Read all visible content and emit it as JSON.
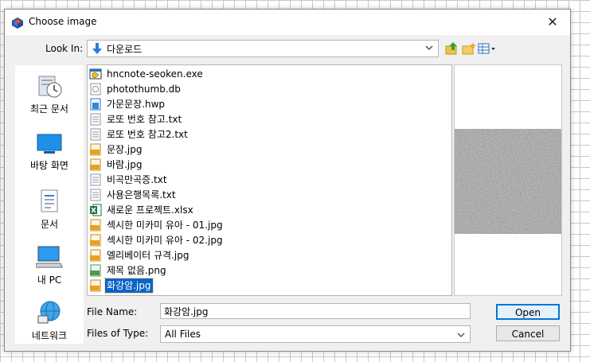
{
  "window": {
    "title": "Choose image",
    "close_glyph": "✕"
  },
  "toolbar": {
    "look_in_label": "Look In:",
    "look_in_value": "다운로드",
    "buttons": [
      "up-folder-icon",
      "new-folder-icon",
      "view-menu-icon"
    ]
  },
  "places": [
    {
      "label": "최근 문서",
      "icon": "recent-documents-icon"
    },
    {
      "label": "바탕 화면",
      "icon": "desktop-icon"
    },
    {
      "label": "문서",
      "icon": "documents-icon"
    },
    {
      "label": "내 PC",
      "icon": "computer-icon"
    },
    {
      "label": "네트워크",
      "icon": "network-icon"
    }
  ],
  "files": [
    {
      "name": "hncnote-seoken.exe",
      "icon": "exe-icon"
    },
    {
      "name": "photothumb.db",
      "icon": "db-file-icon"
    },
    {
      "name": "가문문장.hwp",
      "icon": "hwp-file-icon"
    },
    {
      "name": "로또 번호 참고.txt",
      "icon": "text-file-icon"
    },
    {
      "name": "로또 번호 참고2.txt",
      "icon": "text-file-icon"
    },
    {
      "name": "문장.jpg",
      "icon": "jpg-file-icon"
    },
    {
      "name": "바람.jpg",
      "icon": "jpg-file-icon"
    },
    {
      "name": "비곡만곡증.txt",
      "icon": "text-file-icon"
    },
    {
      "name": "사용은행목록.txt",
      "icon": "text-file-icon"
    },
    {
      "name": "새로운 프로젝트.xlsx",
      "icon": "excel-file-icon"
    },
    {
      "name": "섹시한 미카미 유아 - 01.jpg",
      "icon": "jpg-file-icon"
    },
    {
      "name": "섹시한 미카미 유아 - 02.jpg",
      "icon": "jpg-file-icon"
    },
    {
      "name": "엘리베이터 규격.jpg",
      "icon": "jpg-file-icon"
    },
    {
      "name": "제목 없음.png",
      "icon": "png-file-icon"
    },
    {
      "name": "화강암.jpg",
      "icon": "jpg-file-icon",
      "selected": true
    }
  ],
  "form": {
    "file_name_label": "File Name:",
    "file_name_value": "화강암.jpg",
    "file_type_label": "Files of Type:",
    "file_type_value": "All Files"
  },
  "buttons": {
    "open": "Open",
    "cancel": "Cancel"
  },
  "colors": {
    "selection": "#0a64c8",
    "dialog_bg": "#f0f0f0",
    "open_border": "#0078d7"
  }
}
